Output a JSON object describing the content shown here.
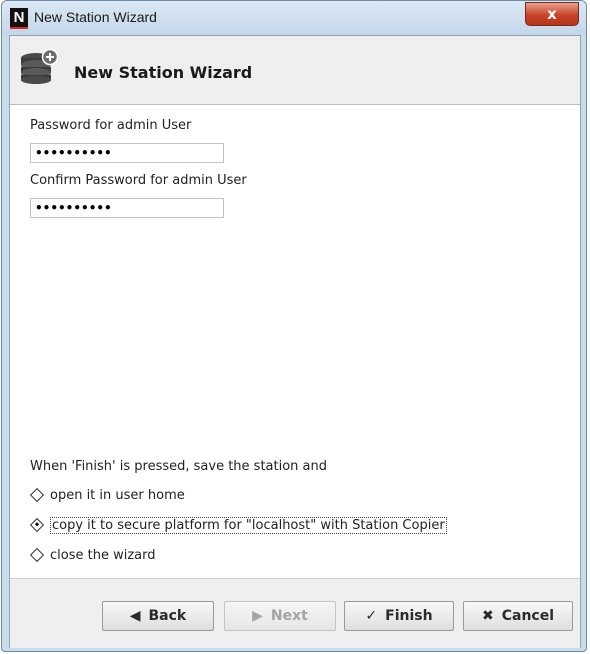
{
  "window": {
    "title": "New Station Wizard",
    "close_glyph": "x",
    "logo_letter": "N"
  },
  "header": {
    "title": "New Station Wizard",
    "icon": "station-database-add-icon"
  },
  "fields": {
    "password_label": "Password for admin User",
    "password_value": "••••••••••",
    "confirm_label": "Confirm Password for admin User",
    "confirm_value": "••••••••••"
  },
  "finish_options": {
    "label": "When 'Finish' is pressed, save the station and",
    "options": [
      {
        "label": "open it in user home",
        "selected": false
      },
      {
        "label": "copy it to secure platform for \"localhost\" with Station Copier",
        "selected": true
      },
      {
        "label": "close the wizard",
        "selected": false
      }
    ]
  },
  "buttons": {
    "back": {
      "label": "Back",
      "icon": "triangle-left-icon"
    },
    "next": {
      "label": "Next",
      "icon": "triangle-right-icon",
      "disabled": true
    },
    "finish": {
      "label": "Finish",
      "icon": "checkmark-icon"
    },
    "cancel": {
      "label": "Cancel",
      "icon": "x-icon"
    }
  }
}
